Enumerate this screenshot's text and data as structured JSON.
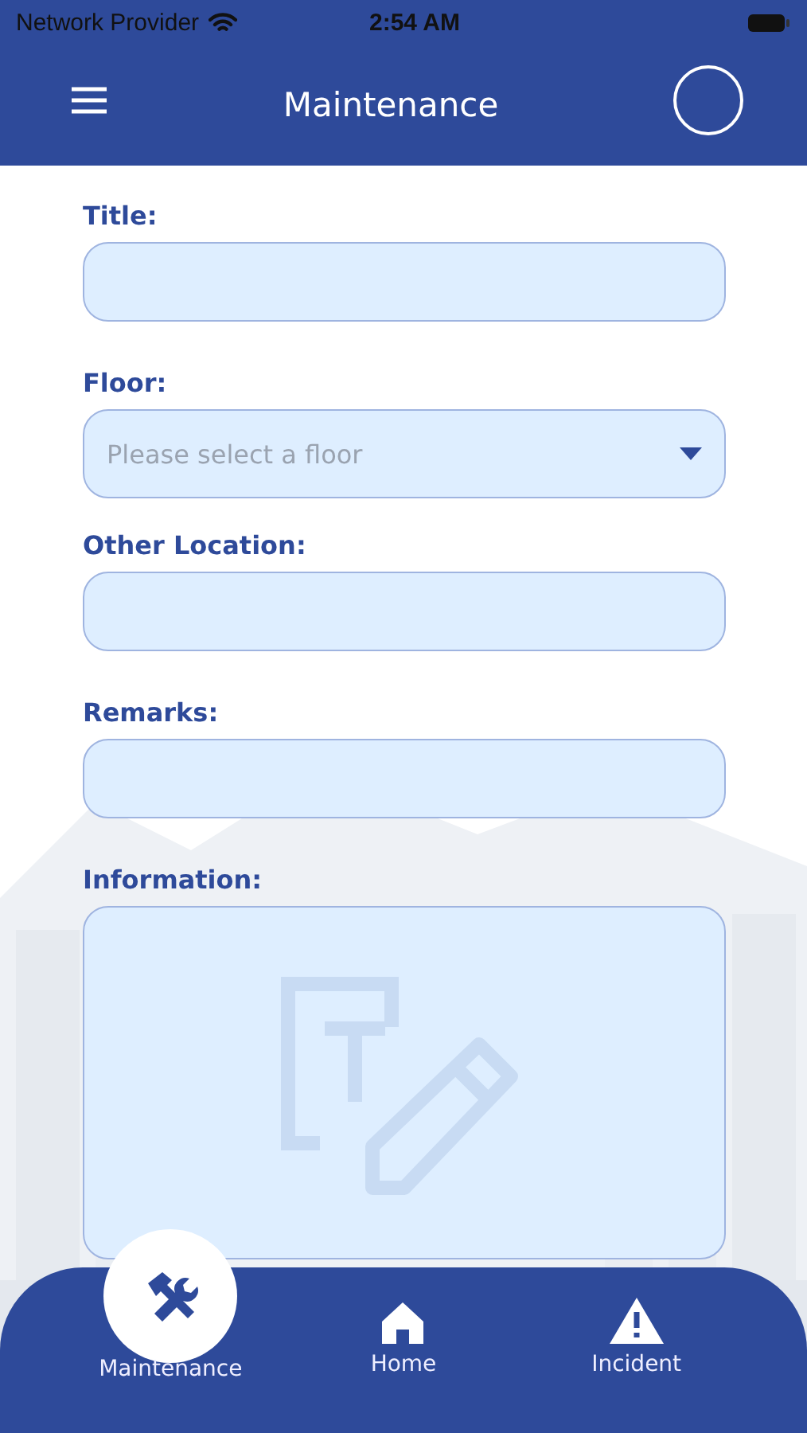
{
  "status_bar": {
    "carrier": "Network Provider",
    "time": "2:54 AM"
  },
  "header": {
    "title": "Maintenance"
  },
  "form": {
    "fields": [
      {
        "label": "Title:",
        "kind": "text"
      },
      {
        "label": "Floor:",
        "kind": "select",
        "placeholder": "Please select a floor"
      },
      {
        "label": "Other Location:",
        "kind": "text"
      },
      {
        "label": "Remarks:",
        "kind": "text"
      },
      {
        "label": "Information:",
        "kind": "textarea"
      }
    ]
  },
  "tab_bar": {
    "items": [
      {
        "label": "Maintenance",
        "selected": true
      },
      {
        "label": "Home",
        "selected": false
      },
      {
        "label": "Incident",
        "selected": false
      }
    ]
  }
}
